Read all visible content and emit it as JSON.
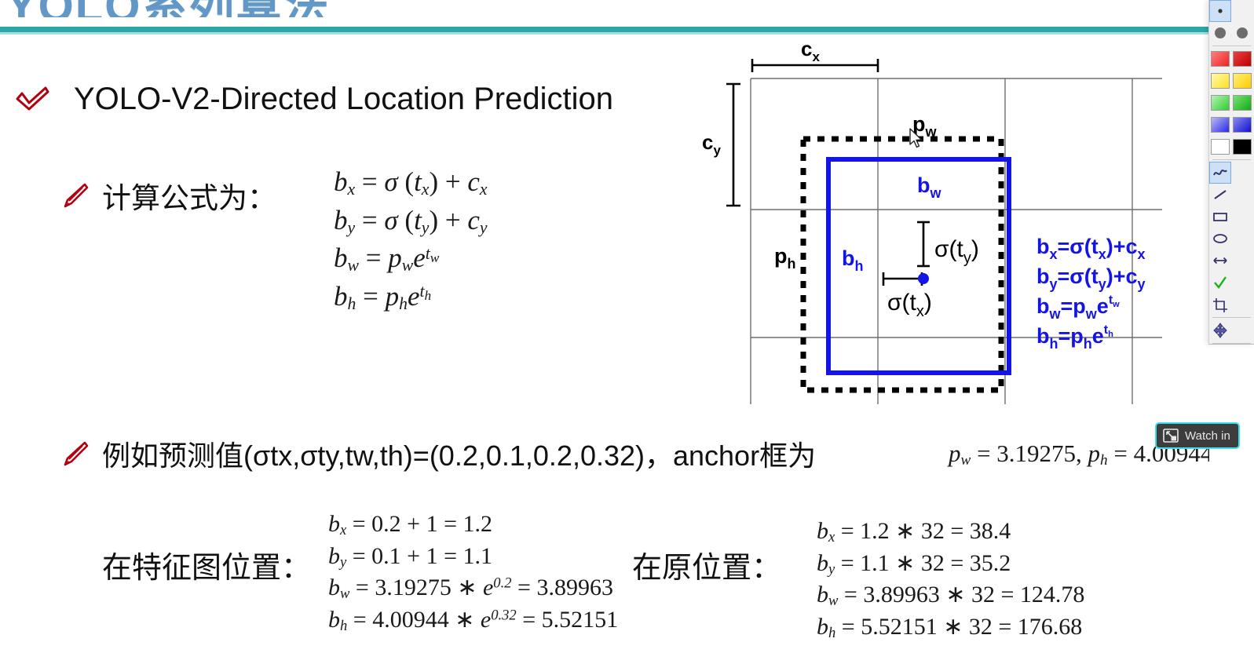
{
  "slide": {
    "top_title_partial": "YOLO系列算法",
    "divider_color": "#28a8a8",
    "bullets": {
      "item1": "YOLO-V2-Directed Location Prediction",
      "item2": "计算公式为：",
      "item3": "例如预测值(σtx,σty,tw,th)=(0.2,0.1,0.2,0.32)，anchor框为"
    },
    "main_formulas": [
      "b_x = σ (t_x) + c_x",
      "b_y = σ (t_y) + c_y",
      "b_w = p_w e^{t_w}",
      "b_h = p_h e^{t_h}"
    ],
    "anchor_values": "p_w = 3.19275, p_h = 4.00944",
    "anchor_pw": "3.19275",
    "anchor_ph": "4.00944",
    "feature_map": {
      "label": "在特征图位置：",
      "lines": [
        "b_x = 0.2 + 1 = 1.2",
        "b_y = 0.1 + 1 = 1.1",
        "b_w = 3.19275 * e^{0.2} = 3.89963",
        "b_h = 4.00944 * e^{0.32} = 5.52151"
      ],
      "values": {
        "bx": "1.2",
        "by": "1.1",
        "bw": "3.89963",
        "bh": "5.52151"
      }
    },
    "original": {
      "label": "在原位置：",
      "scale": "32",
      "lines": [
        "b_x = 1.2 * 32 = 38.4",
        "b_y = 1.1 * 32 = 35.2",
        "b_w = 3.89963 * 32 = 124.78",
        "b_h = 5.52151 * 32 = 176.68"
      ],
      "values": {
        "bx": "38.4",
        "by": "35.2",
        "bw": "124.78",
        "bh": "176.68"
      }
    }
  },
  "diagram": {
    "labels": {
      "cx": "c",
      "cx_sub": "x",
      "cy": "c",
      "cy_sub": "y",
      "pw": "p",
      "pw_sub": "w",
      "ph": "p",
      "ph_sub": "h",
      "bw": "b",
      "bw_sub": "w",
      "bh": "b",
      "bh_sub": "h",
      "sigma_tx": "σ(t",
      "sigma_tx_sub": "x",
      "sigma_ty": "σ(t",
      "sigma_ty_sub": "y"
    },
    "side_formulas": [
      "b_x=σ(t_x)+c_x",
      "b_y=σ(t_y)+c_y",
      "b_w=p_w e^{t_w}",
      "b_h=p_h e^{t_h}"
    ],
    "colors": {
      "box_blue": "#1414e6",
      "grid_gray": "#6e6e6e",
      "anchor_dotted": "#000000"
    }
  },
  "overlay": {
    "watch_in_label": "Watch in",
    "watch_in_icon": "picture-in-picture-icon",
    "accent_color": "#3ae0ec"
  },
  "toolbar": {
    "name": "annotation-toolbar",
    "pointer_row": [
      "pointer-dot-tool",
      "filled-dot-tool"
    ],
    "swatches": [
      [
        "#ee3333",
        "#cc1111"
      ],
      [
        "#ffe833",
        "#ffd400"
      ],
      [
        "#55dd55",
        "#22bb22"
      ],
      [
        "#5555ee",
        "#2222cc"
      ],
      [
        "#ffffff",
        "#000000"
      ]
    ],
    "tools": [
      "freehand-pen-tool",
      "line-tool",
      "rectangle-tool",
      "ellipse-tool",
      "arrow-tool",
      "checkmark-tool",
      "crop-tool",
      "move-tool",
      "undo-tool",
      "new-page-tool",
      "print-tool",
      "screenshot-tool"
    ],
    "selected_tool": "freehand-pen-tool"
  }
}
